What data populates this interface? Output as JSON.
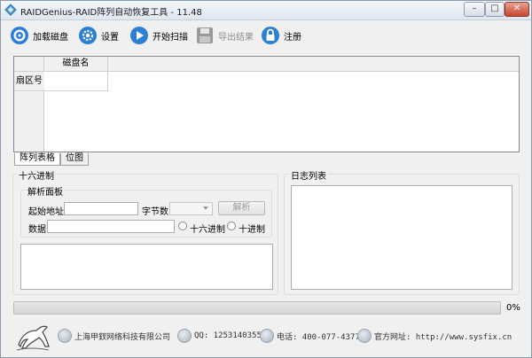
{
  "window": {
    "title": "RAIDGenius-RAID阵列自动恢复工具 - 11.48",
    "controls": {
      "minimize": "–",
      "maximize": "□",
      "close": "✕"
    }
  },
  "toolbar": {
    "load_disk": "加载磁盘",
    "settings": "设置",
    "start_scan": "开始扫描",
    "export": "导出结果",
    "register": "注册"
  },
  "grid": {
    "column_header": "磁盘名",
    "row_header": "扇区号"
  },
  "tabs": [
    "阵列表格",
    "位图"
  ],
  "hex_panel": {
    "title": "十六进制",
    "parse_group": {
      "title": "解析面板",
      "start_address_label": "起始地址",
      "start_address_value": "",
      "byte_count_label": "字节数",
      "byte_count_value": "",
      "parse_button": "解析",
      "data_label": "数据",
      "data_value": "",
      "radio_hex": "十六进制",
      "radio_dec": "十进制"
    }
  },
  "log_panel": {
    "title": "日志列表"
  },
  "progress": {
    "value": 0,
    "label": "0%"
  },
  "footer": {
    "company": "上海甲釵网络科技有限公司",
    "qq": "QQ: 1253140355",
    "phone": "电话: 400-077-4377",
    "website": "官方网址: http://www.sysfix.cn"
  },
  "colors": {
    "accent_blue": "#1f6fc9",
    "progress_green": "#3ab03a"
  }
}
